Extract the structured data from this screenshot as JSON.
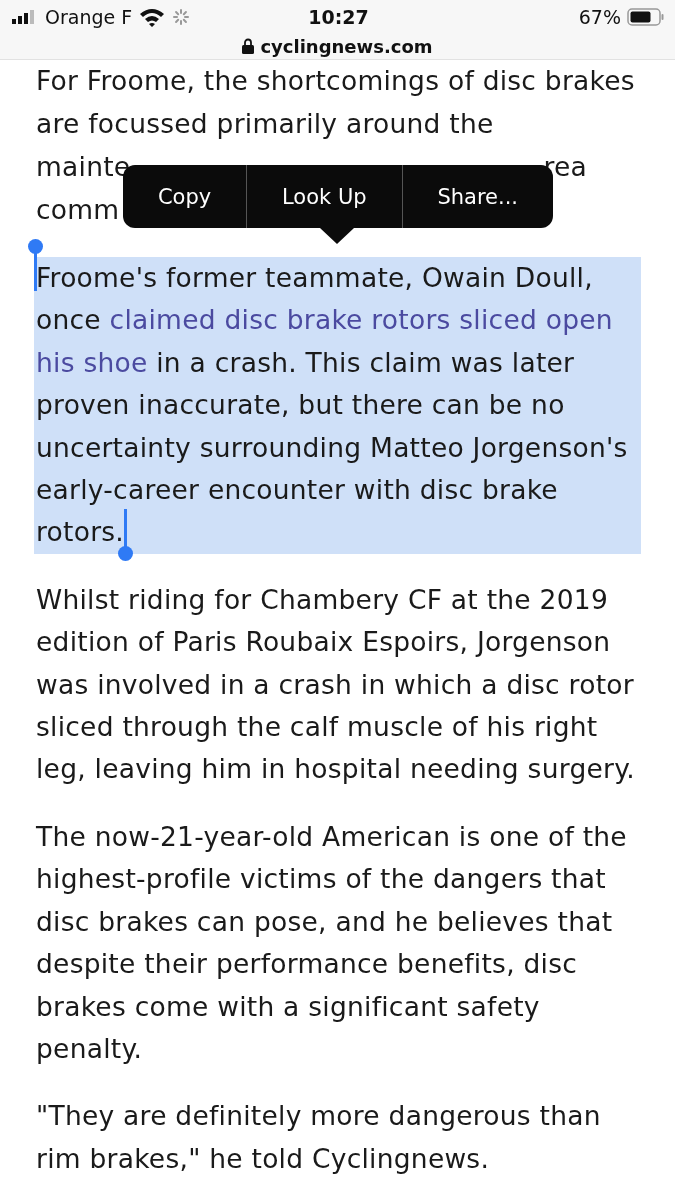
{
  "status_bar": {
    "carrier": "Orange F",
    "time": "10:27",
    "battery": "67%"
  },
  "address_bar": {
    "url": "cyclingnews.com"
  },
  "article": {
    "paragraphs": [
      {
        "kind": "partial",
        "lines": [
          [
            "For Froome, the shortcomings of disc brakes"
          ],
          [
            "are focussed primarily around the"
          ],
          [
            "mainte",
            "rea"
          ],
          [
            "comm"
          ]
        ]
      },
      {
        "kind": "text",
        "selected": true,
        "segments": [
          {
            "kind": "plain",
            "text": "Froome's former teammate, Owain Doull, once "
          },
          {
            "kind": "link",
            "text": "claimed disc brake rotors sliced open"
          },
          {
            "kind": "link",
            "text": "his shoe"
          },
          {
            "kind": "plain",
            "text": " in a crash. This claim was later proven inaccurate, but there can be no uncertainty surrounding Matteo Jorgenson's early-career encounter with disc brake rotors."
          }
        ]
      },
      {
        "kind": "text",
        "selected": false,
        "segments": [
          {
            "kind": "plain",
            "text": "Whilst riding for Chambery CF at the 2019 edition of Paris Roubaix Espoirs, Jorgenson was involved in a crash in which a disc rotor sliced through the calf muscle of his right leg, leaving him in hospital needing surgery."
          }
        ]
      },
      {
        "kind": "text",
        "selected": false,
        "segments": [
          {
            "kind": "plain",
            "text": "The now-21-year-old American is one of the highest-profile victims of the dangers that disc brakes can pose, and he believes that despite their performance benefits, disc brakes come with a significant safety penalty."
          }
        ]
      },
      {
        "kind": "text",
        "selected": false,
        "segments": [
          {
            "kind": "plain",
            "text": "\"They are definitely more dangerous than rim brakes,\" he told Cyclingnews."
          }
        ]
      }
    ]
  },
  "context_menu": {
    "items": [
      "Copy",
      "Look Up",
      "Share..."
    ]
  }
}
